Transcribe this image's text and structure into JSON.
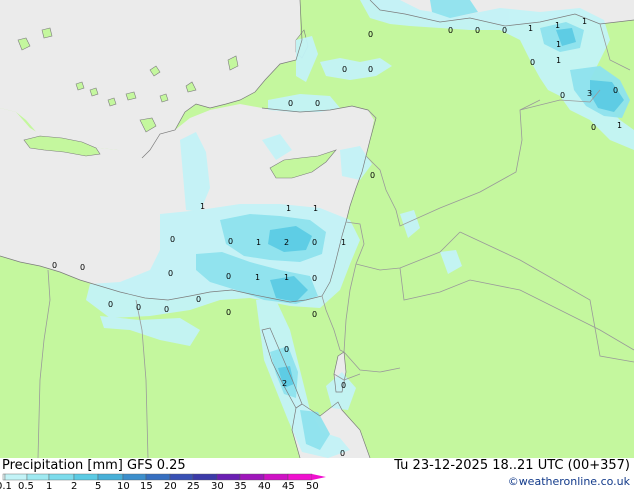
{
  "footer": {
    "title": "Precipitation [mm]  GFS 0.25",
    "run": "Tu 23-12-2025 18..21 UTC (00+357)",
    "credit": "©weatheronline.co.uk"
  },
  "legend": {
    "ticks": [
      "0.1",
      "0.5",
      "1",
      "2",
      "5",
      "10",
      "15",
      "20",
      "25",
      "30",
      "35",
      "40",
      "45",
      "50"
    ],
    "colors": [
      "#e8fbfc",
      "#c3f3f7",
      "#9fe9f1",
      "#7ddcec",
      "#5ccbe4",
      "#48b0d8",
      "#3d8fcc",
      "#366fc0",
      "#3850b4",
      "#3b3aa8",
      "#6a1fb3",
      "#9f16bb",
      "#cf12c5",
      "#f010cf"
    ]
  },
  "map": {
    "colors": {
      "sea": "#ebebeb",
      "land": "#c4f79e",
      "precip_light": "#c3f3f7",
      "precip_mid": "#8fe3ee",
      "precip_strong": "#5ccbe4",
      "border": "#9a9a9a",
      "coast": "#7c7c7c"
    },
    "point_labels": [
      {
        "id": "p-top-a",
        "text": "0"
      },
      {
        "id": "p-top-b",
        "text": "0"
      },
      {
        "id": "p-top-c",
        "text": "0"
      },
      {
        "id": "p-top-d",
        "text": "1"
      },
      {
        "id": "p-top-e",
        "text": "1"
      },
      {
        "id": "p-top-f",
        "text": "1"
      },
      {
        "id": "p-top-g",
        "text": "1"
      },
      {
        "id": "p-north-a",
        "text": "0"
      },
      {
        "id": "p-north-b",
        "text": "0"
      },
      {
        "id": "p-north-c",
        "text": "0"
      },
      {
        "id": "p-aeg-a",
        "text": "0"
      },
      {
        "id": "p-aeg-b",
        "text": "0"
      },
      {
        "id": "p-iraq-a",
        "text": "0"
      },
      {
        "id": "p-iraq-b",
        "text": "1"
      },
      {
        "id": "p-iraq-c",
        "text": "0"
      },
      {
        "id": "p-iraq-d",
        "text": "3"
      },
      {
        "id": "p-iraq-e",
        "text": "0"
      },
      {
        "id": "p-iraq-f",
        "text": "0"
      },
      {
        "id": "p-iraq-g",
        "text": "1"
      },
      {
        "id": "p-leb",
        "text": "0"
      },
      {
        "id": "p-em-a",
        "text": "1"
      },
      {
        "id": "p-em-b",
        "text": "1"
      },
      {
        "id": "p-em-c",
        "text": "1"
      },
      {
        "id": "p-em-d",
        "text": "0"
      },
      {
        "id": "p-em-e",
        "text": "0"
      },
      {
        "id": "p-em-f",
        "text": "1"
      },
      {
        "id": "p-em-g",
        "text": "2"
      },
      {
        "id": "p-em-h",
        "text": "0"
      },
      {
        "id": "p-em-i",
        "text": "1"
      },
      {
        "id": "p-em-j",
        "text": "0"
      },
      {
        "id": "p-em-k",
        "text": "0"
      },
      {
        "id": "p-em-l",
        "text": "1"
      },
      {
        "id": "p-em-m",
        "text": "1"
      },
      {
        "id": "p-em-n",
        "text": "0"
      },
      {
        "id": "p-lib-a",
        "text": "0"
      },
      {
        "id": "p-lib-b",
        "text": "0"
      },
      {
        "id": "p-eg-a",
        "text": "0"
      },
      {
        "id": "p-eg-b",
        "text": "0"
      },
      {
        "id": "p-eg-c",
        "text": "0"
      },
      {
        "id": "p-eg-d",
        "text": "0"
      },
      {
        "id": "p-eg-e",
        "text": "0"
      },
      {
        "id": "p-sinai-a",
        "text": "0"
      },
      {
        "id": "p-sinai-b",
        "text": "2"
      },
      {
        "id": "p-sinai-c",
        "text": "0"
      }
    ]
  }
}
